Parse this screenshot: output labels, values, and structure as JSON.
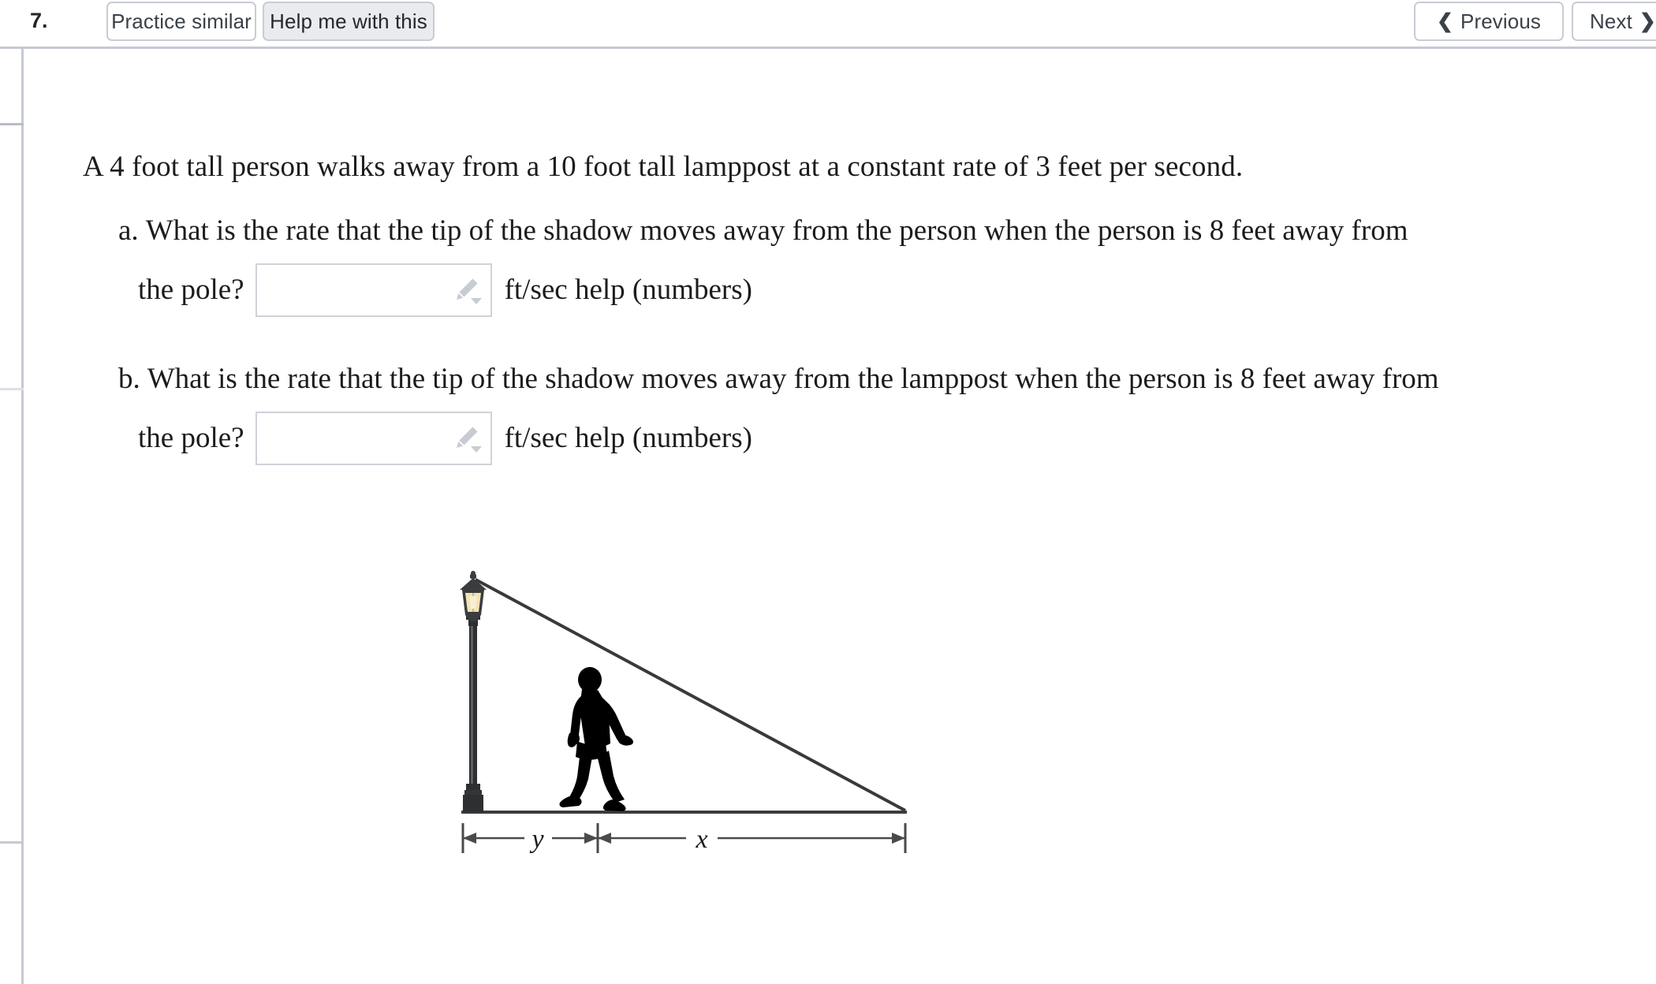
{
  "header": {
    "question_number": "7.",
    "practice_label": "Practice similar",
    "help_label": "Help me with this",
    "previous_label": "Previous",
    "next_label": "Next",
    "prev_chevron": "chevron-left-icon",
    "next_chevron": "chevron-right-icon"
  },
  "problem": {
    "stem": "A 4 foot tall person walks away from a 10 foot tall lamppost at a constant rate of 3 feet per second.",
    "parts": [
      {
        "label": "a.",
        "line1": "What is the rate that the tip of the shadow moves away from the person when the person is 8 feet away from",
        "line2": "the pole?",
        "answer_value": "",
        "answer_placeholder": "",
        "units": "ft/sec help (numbers)",
        "editor_icon": "pencil-icon",
        "dropdown_icon": "triangle-down-icon"
      },
      {
        "label": "b.",
        "line1": "What is the rate that the tip of the shadow moves away from the lamppost when the person is 8 feet away from",
        "line2": "the pole?",
        "answer_value": "",
        "answer_placeholder": "",
        "units": "ft/sec help (numbers)",
        "editor_icon": "pencil-icon",
        "dropdown_icon": "triangle-down-icon"
      }
    ]
  },
  "figure": {
    "title": "lamppost-shadow-diagram",
    "lamppost_label": "lamppost",
    "person_label": "walking-person-silhouette",
    "dimension_y": "y",
    "dimension_x": "x",
    "colors": {
      "pole": "#2d2f31",
      "lamp_glass": "#f3e3b4",
      "lamp_frame": "#3a3c3e",
      "person": "#000000",
      "ground": "#3c3c3c",
      "ray": "#3a3a3a",
      "dimension": "#4a4a4a"
    }
  }
}
